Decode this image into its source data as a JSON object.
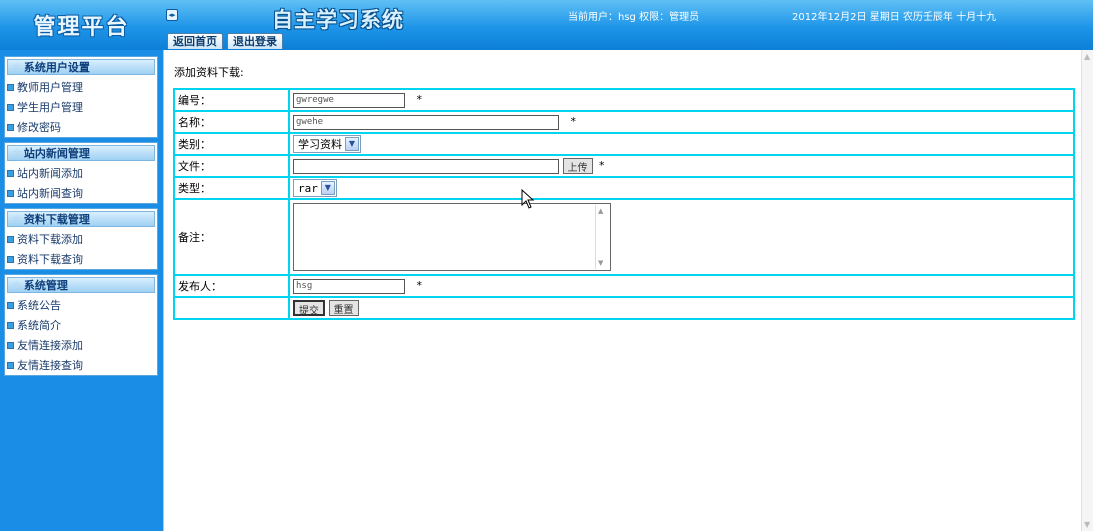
{
  "header": {
    "brand": "管理平台",
    "toggle_icon": "◂▸",
    "system_title": "自主学习系统",
    "user_info": "当前用户：hsg  权限：管理员",
    "date_info": "2012年12月2日 星期日 农历壬辰年 十月十九",
    "tabs": [
      {
        "label": "返回首页"
      },
      {
        "label": "退出登录"
      }
    ]
  },
  "sidebar": {
    "groups": [
      {
        "title": "系统用户设置",
        "items": [
          "教师用户管理",
          "学生用户管理",
          "修改密码"
        ]
      },
      {
        "title": "站内新闻管理",
        "items": [
          "站内新闻添加",
          "站内新闻查询"
        ]
      },
      {
        "title": "资料下载管理",
        "items": [
          "资料下载添加",
          "资料下载查询"
        ]
      },
      {
        "title": "系统管理",
        "items": [
          "系统公告",
          "系统简介",
          "友情连接添加",
          "友情连接查询"
        ]
      }
    ]
  },
  "main": {
    "heading": "添加资料下载:",
    "form": {
      "id_label": "编号：",
      "id_value": "gwregwe",
      "name_label": "名称：",
      "name_value": "gwehe",
      "category_label": "类别：",
      "category_value": "学习资料",
      "file_label": "文件：",
      "file_value": "",
      "upload_label": "上传",
      "type_label": "类型：",
      "type_value": "rar",
      "note_label": "备注：",
      "note_value": "",
      "publisher_label": "发布人：",
      "publisher_value": "hsg",
      "required_mark": "*",
      "submit_label": "提交",
      "reset_label": "重置"
    }
  },
  "colors": {
    "header_blue": "#1e95e8",
    "table_border": "#00d5f0",
    "sidebar_bg": "#1a8ee6"
  }
}
